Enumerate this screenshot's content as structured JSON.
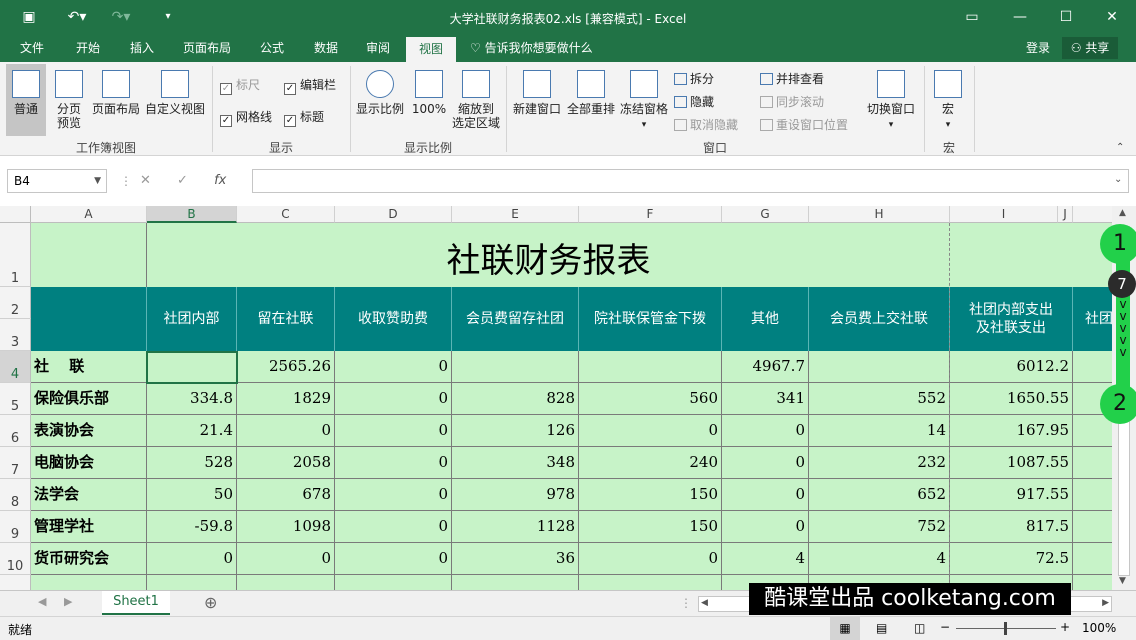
{
  "window": {
    "title": "大学社联财务报表02.xls  [兼容模式] - Excel"
  },
  "tabs": [
    "文件",
    "开始",
    "插入",
    "页面布局",
    "公式",
    "数据",
    "审阅",
    "视图"
  ],
  "tell_me": "告诉我你想要做什么",
  "login": "登录",
  "share": "共享",
  "ribbon": {
    "normal": "普通",
    "page_break_1": "分页",
    "page_break_2": "预览",
    "page_layout": "页面布局",
    "custom_views": "自定义视图",
    "group_workbook_views": "工作簿视图",
    "ruler": "标尺",
    "formula_bar": "编辑栏",
    "gridlines": "网格线",
    "headings": "标题",
    "group_show": "显示",
    "zoom": "显示比例",
    "zoom_100": "100%",
    "zoom_sel_1": "缩放到",
    "zoom_sel_2": "选定区域",
    "group_zoom": "显示比例",
    "new_window": "新建窗口",
    "arrange_all": "全部重排",
    "freeze_panes": "冻结窗格",
    "split": "拆分",
    "hide": "隐藏",
    "unhide": "取消隐藏",
    "view_side": "并排查看",
    "sync_scroll": "同步滚动",
    "reset_pos": "重设窗口位置",
    "switch_windows": "切换窗口",
    "group_window": "窗口",
    "macros": "宏",
    "group_macros": "宏"
  },
  "formula_bar": {
    "name_box": "B4",
    "fx": "fx",
    "value": ""
  },
  "columns": [
    "A",
    "B",
    "C",
    "D",
    "E",
    "F",
    "G",
    "H",
    "I",
    "J"
  ],
  "rows": [
    "1",
    "2",
    "3",
    "4",
    "5",
    "6",
    "7",
    "8",
    "9",
    "10"
  ],
  "sheet_title": "社联财务报表",
  "headers": [
    "社团内部",
    "留在社联",
    "收取赞助费",
    "会员费留存社团",
    "院社联保管金下拨",
    "其他",
    "会员费上交社联",
    "社团内部支出\n及社联支出",
    "社团"
  ],
  "table": [
    [
      "社　 联",
      "",
      "2565.26",
      "0",
      "",
      "",
      "4967.7",
      "",
      "6012.2"
    ],
    [
      "保险俱乐部",
      "334.8",
      "1829",
      "0",
      "828",
      "560",
      "341",
      "552",
      "1650.55"
    ],
    [
      "表演协会",
      "21.4",
      "0",
      "0",
      "126",
      "0",
      "0",
      "14",
      "167.95"
    ],
    [
      "电脑协会",
      "528",
      "2058",
      "0",
      "348",
      "240",
      "0",
      "232",
      "1087.55"
    ],
    [
      "法学会",
      "50",
      "678",
      "0",
      "978",
      "150",
      "0",
      "652",
      "917.55"
    ],
    [
      "管理学社",
      "-59.8",
      "1098",
      "0",
      "1128",
      "150",
      "0",
      "752",
      "817.5"
    ],
    [
      "货币研究会",
      "0",
      "0",
      "0",
      "36",
      "0",
      "4",
      "4",
      "72.5"
    ]
  ],
  "markers": [
    "1",
    "7",
    "2"
  ],
  "sheet_tab": "Sheet1",
  "status": {
    "ready": "就绪",
    "zoom": "100%"
  },
  "watermark": "酷课堂出品 coolketang.com"
}
